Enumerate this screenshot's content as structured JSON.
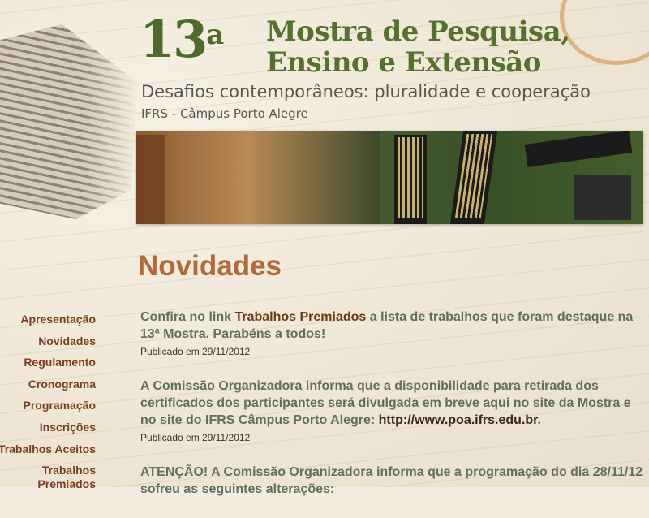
{
  "header": {
    "edition_number": "13",
    "edition_suffix": "a",
    "title_line1": "Mostra de Pesquisa,",
    "title_line2": "Ensino e Extensão",
    "subtitle": "Desafios contemporâneos: pluralidade e cooperação",
    "campus": "IFRS - Câmpus Porto Alegre"
  },
  "section": {
    "title": "Novidades"
  },
  "nav": {
    "items": [
      {
        "label": "Apresentação"
      },
      {
        "label": "Novidades"
      },
      {
        "label": "Regulamento"
      },
      {
        "label": "Cronograma"
      },
      {
        "label": "Programação"
      },
      {
        "label": "Inscrições"
      },
      {
        "label": "Trabalhos Aceitos"
      },
      {
        "label": "Trabalhos Premiados"
      }
    ]
  },
  "posts": [
    {
      "text_before": "Confira no link ",
      "link": "Trabalhos Premiados",
      "text_after": " a lista de trabalhos que foram destaque na 13ª Mostra. Parabéns a todos!",
      "date": "Publicado em 29/11/2012"
    },
    {
      "text_before": "A Comissão Organizadora informa que a disponibilidade para retirada dos certificados dos participantes será divulgada em breve aqui no site da Mostra e no site do IFRS Câmpus Porto Alegre: ",
      "link": "http://www.poa.ifrs.edu.br",
      "text_after": ".",
      "date": "Publicado em 29/11/2012"
    },
    {
      "text_before": "ATENÇÃO! A Comissão Organizadora informa que a programação do dia 28/11/12 sofreu as seguintes alterações:"
    }
  ]
}
